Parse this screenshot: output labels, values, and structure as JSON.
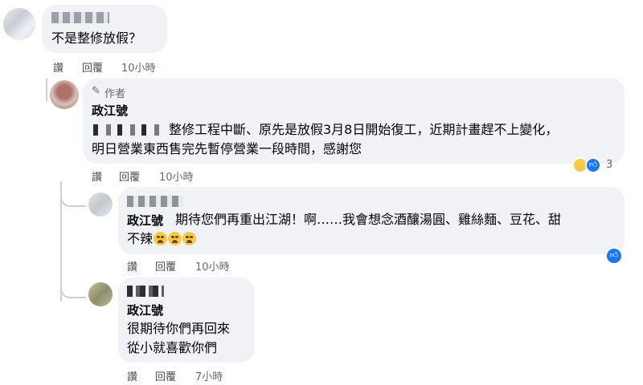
{
  "comments": [
    {
      "text_lines": [
        "不是整修放假？"
      ],
      "actions": {
        "like": "讚",
        "reply": "回覆",
        "time": "10小時"
      }
    },
    {
      "author_badge": "作者",
      "author": "政江號",
      "text_lines": [
        "整修工程中斷、原先是放假3月8日開始復工，近期計畫趕不上變化，",
        "明日營業東西售完先暫停營業一段時間，感謝您"
      ],
      "actions": {
        "like": "讚",
        "reply": "回覆",
        "time": "10小時"
      },
      "reactions": {
        "count": "3",
        "icons": [
          "sad-reaction-icon",
          "like-reaction-icon"
        ]
      }
    },
    {
      "mention": "政江號",
      "text_lines": [
        "期待您們再重出江湖！啊……我會想念酒釀湯圓、雞絲麵、豆花、甜",
        "不辣"
      ],
      "actions": {
        "like": "讚",
        "reply": "回覆",
        "time": "10小時"
      },
      "reactions": {
        "icons": [
          "like-reaction-icon"
        ]
      }
    },
    {
      "mention": "政江號",
      "text_lines": [
        "很期待你們再回來",
        "從小就喜歡你們"
      ],
      "actions": {
        "like": "讚",
        "reply": "回覆",
        "time": "7小時"
      }
    }
  ],
  "colors": {
    "bubble": "#f0f2f5",
    "like_blue": "#1877f2",
    "meta_text": "#65676b",
    "sad_yellow": "#f7c948"
  }
}
